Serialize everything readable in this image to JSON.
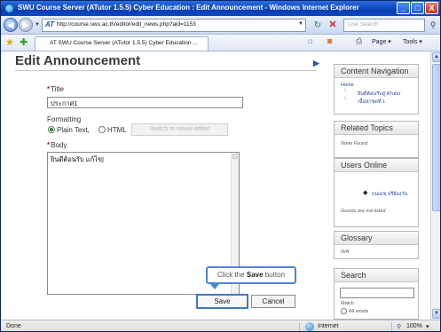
{
  "window": {
    "title": "SWU Course Server (ATutor 1.5.5) Cyber Education : Edit Announcement - Windows Internet Explorer",
    "minimize": "_",
    "maximize": "□",
    "close": "X"
  },
  "address_bar": {
    "url": "http://course.swu.ac.th/editor/edit_news.php?aid=1153",
    "logo": "AT",
    "search_placeholder": "Live Search"
  },
  "tab": {
    "title": "AT SWU Course Server (ATutor 1.5.5) Cyber Education ..."
  },
  "commands": {
    "page": "Page ▾",
    "tools": "Tools ▾"
  },
  "form": {
    "page_title": "Edit Announcement",
    "title_label": "Title",
    "title_value": "ประกาศ1",
    "formatting_label": "Formatting",
    "plain_text": "Plain Text,",
    "html": "HTML",
    "visual_editor_button": "Switch to visual editor",
    "body_label": "Body",
    "body_value": "ยินดีต้อนรับ แก้ไข|",
    "save_button": "Save",
    "cancel_button": "Cancel",
    "callout_prefix": "Click the ",
    "callout_bold": "Save",
    "callout_suffix": " button"
  },
  "sidebar": {
    "content_navigation": {
      "header": "Content Navigation",
      "home": "Home",
      "item1": "ยินดีต้อนรับสู่ ATutor",
      "item2": "เนื้อหาชุดที่ 1"
    },
    "related_topics": {
      "header": "Related Topics",
      "text": "None Found"
    },
    "users_online": {
      "header": "Users Online",
      "user": "ธนเดช ปรีย์ยงวัน",
      "guests": "Guests are not listed"
    },
    "glossary": {
      "header": "Glossary",
      "text": "N/A"
    },
    "search": {
      "header": "Search",
      "match": "Match",
      "all_words": "All words"
    }
  },
  "status_bar": {
    "left": "Done",
    "zone": "Internet",
    "zoom": "100%"
  }
}
